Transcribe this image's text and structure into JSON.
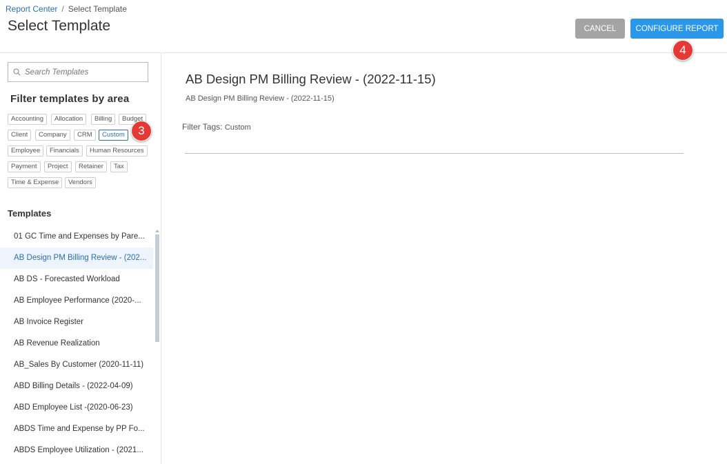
{
  "breadcrumb": {
    "root": "Report Center",
    "separator": "/",
    "current": "Select Template"
  },
  "page_title": "Select Template",
  "actions": {
    "cancel_label": "CANCEL",
    "configure_label": "CONFIGURE REPORT"
  },
  "annotations": {
    "step_3": "3",
    "step_4": "4"
  },
  "sidebar": {
    "search_placeholder": "Search Templates",
    "filter_heading": "Filter templates by area",
    "tags": [
      "Accounting",
      "Allocation",
      "Billing",
      "Budget",
      "Client",
      "Company",
      "CRM",
      "Custom",
      "Employee",
      "Financials",
      "Human Resources",
      "Payment",
      "Project",
      "Retainer",
      "Tax",
      "Time & Expense",
      "Vendors"
    ],
    "selected_tag": "Custom",
    "templates_heading": "Templates",
    "templates": [
      "01 GC Time and Expenses by Pare...",
      "AB Design PM Billing Review - (202...",
      "AB DS - Forecasted Workload",
      "AB Employee Performance (2020-...",
      "AB Invoice Register",
      "AB Revenue Realization",
      "AB_Sales By Customer (2020-11-11)",
      "ABD Billing Details - (2022-04-09)",
      "ABD Employee List -(2020-06-23)",
      "ABDS Time and Expense by PP Fo...",
      "ABDS Employee Utilization - (2021..."
    ],
    "active_template": "AB Design PM Billing Review - (202..."
  },
  "detail": {
    "title": "AB Design PM Billing Review - (2022-11-15)",
    "subtitle": "AB Design PM Billing Review - (2022-11-15)",
    "filter_tags_label": "Filter Tags:",
    "filter_tags_value": "Custom"
  },
  "colors": {
    "accent": "#2b97eb",
    "link": "#2a6fb0",
    "cancel": "#a4a4a4",
    "badge": "#e53935"
  }
}
